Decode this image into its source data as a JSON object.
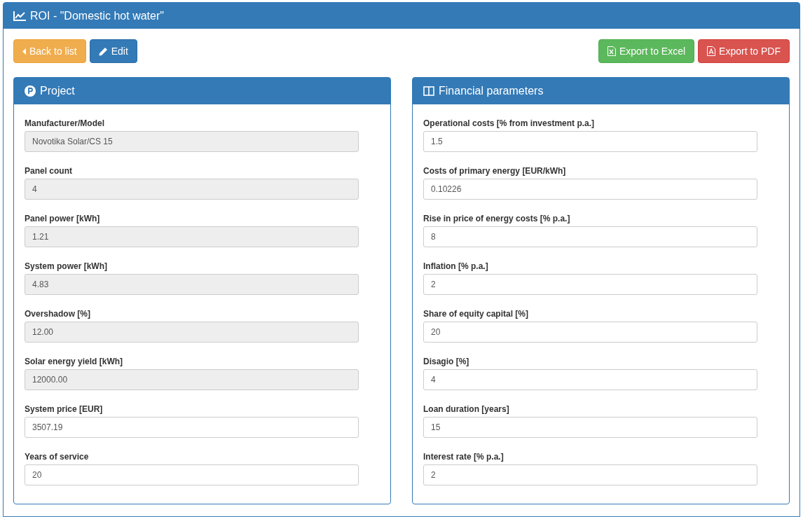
{
  "window": {
    "title": "ROI - \"Domestic hot water\""
  },
  "toolbar": {
    "left": [
      {
        "kind": "back",
        "label": "Back to list"
      },
      {
        "kind": "edit",
        "label": "Edit"
      }
    ],
    "right": [
      {
        "kind": "excel",
        "label": "Export to Excel"
      },
      {
        "kind": "pdf",
        "label": "Export to PDF"
      }
    ]
  },
  "panels": [
    {
      "kind": "project",
      "title": "Project",
      "fields": [
        {
          "label": "Manufacturer/Model",
          "value": "Novotika Solar/CS 15",
          "disabled": true
        },
        {
          "label": "Panel count",
          "value": "4",
          "disabled": true
        },
        {
          "label": "Panel power [kWh]",
          "value": "1.21",
          "disabled": true
        },
        {
          "label": "System power [kWh]",
          "value": "4.83",
          "disabled": true
        },
        {
          "label": "Overshadow [%]",
          "value": "12.00",
          "disabled": true
        },
        {
          "label": "Solar energy yield [kWh]",
          "value": "12000.00",
          "disabled": true
        },
        {
          "label": "System price [EUR]",
          "value": "3507.19",
          "disabled": false
        },
        {
          "label": "Years of service",
          "value": "20",
          "disabled": false
        }
      ]
    },
    {
      "kind": "financial",
      "title": "Financial parameters",
      "fields": [
        {
          "label": "Operational costs [% from investment p.a.]",
          "value": "1.5",
          "disabled": false
        },
        {
          "label": "Costs of primary energy [EUR/kWh]",
          "value": "0.10226",
          "disabled": false
        },
        {
          "label": "Rise in price of energy costs [% p.a.]",
          "value": "8",
          "disabled": false
        },
        {
          "label": "Inflation [% p.a.]",
          "value": "2",
          "disabled": false
        },
        {
          "label": "Share of equity capital [%]",
          "value": "20",
          "disabled": false
        },
        {
          "label": "Disagio [%]",
          "value": "4",
          "disabled": false
        },
        {
          "label": "Loan duration [years]",
          "value": "15",
          "disabled": false
        },
        {
          "label": "Interest rate [% p.a.]",
          "value": "2",
          "disabled": false
        }
      ]
    }
  ]
}
